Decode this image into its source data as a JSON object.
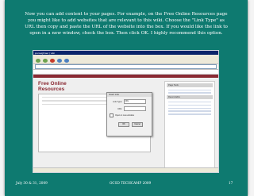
{
  "slide": {
    "instructions": "Now you can add content to your pages. For example, on the Free Online Resources page you might like to add websites that are relevant to this wiki. Choose the \"Link Type\" as URL then copy and paste the URL of the website into the box. If you would like the link to open in a new window, check the box. Then click OK. I highly recommend this option.",
    "footer_left": "July 30 & 31, 2009",
    "footer_center": "OCSD TECHCAMP 2009",
    "footer_right": "17"
  },
  "screenshot": {
    "site_title": "Free Online Resources",
    "wiki_name": "josmeighraer | wiki",
    "dialog": {
      "title": "Insert Link",
      "link_type_label": "Link Type:",
      "link_type_value": "URL",
      "url_label": "URL:",
      "new_window_label": "Open in new window",
      "ok_label": "OK",
      "cancel_label": "Cancel"
    },
    "right_panel": {
      "heading1": "Page Tools",
      "heading2": "Recent Edits"
    }
  }
}
